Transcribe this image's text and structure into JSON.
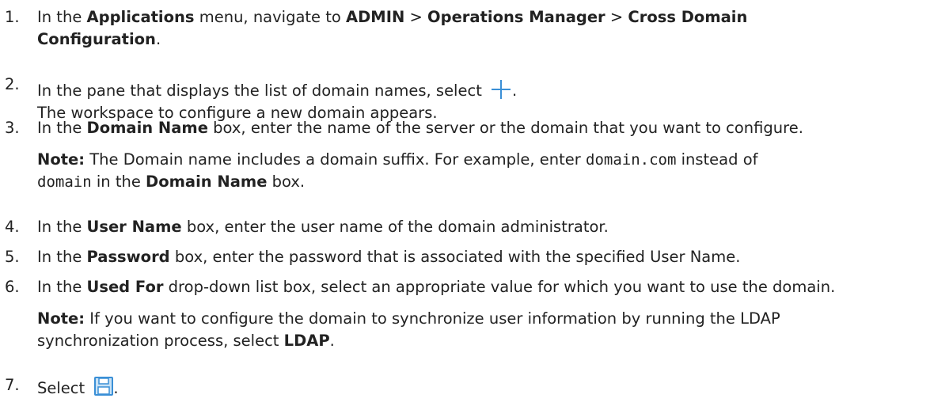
{
  "steps": [
    {
      "num": "1.",
      "a": "In the ",
      "b1": "Applications",
      "c": " menu, navigate to ",
      "b2": "ADMIN",
      "d": " > ",
      "b3": "Operations Manager",
      "e": " > ",
      "b4": "Cross Domain",
      "b5": "Configuration",
      "f": "."
    },
    {
      "num": "2.",
      "a": "In the pane that displays the list of domain names, select ",
      "icon": "plus-icon",
      "b": ".",
      "c": "The workspace to configure a new domain appears."
    },
    {
      "num": "3.",
      "a": "In the ",
      "b1": "Domain Name",
      "c": " box, enter the name of the server or the domain that you want to configure.",
      "note_label": "Note:",
      "note_a": " The Domain name includes a domain suffix. For example, enter ",
      "code1": "domain.com",
      "note_b": " instead of",
      "code2": "domain",
      "note_c": " in the ",
      "note_b2": "Domain Name",
      "note_d": " box."
    },
    {
      "num": "4.",
      "a": "In the ",
      "b1": "User Name",
      "c": " box, enter the user name of the domain administrator."
    },
    {
      "num": "5.",
      "a": "In the ",
      "b1": "Password",
      "c": " box, enter the password that is associated with the specified User Name."
    },
    {
      "num": "6.",
      "a": "In the ",
      "b1": "Used For",
      "c": " drop-down list box, select an appropriate value for which you want to use the domain.",
      "note_label": "Note:",
      "note_a": " If you want to configure the domain to synchronize user information by running the LDAP",
      "note_b": "synchronization process, select ",
      "note_b2": "LDAP",
      "note_c": "."
    },
    {
      "num": "7.",
      "a": "Select ",
      "icon": "save-icon",
      "b": "."
    }
  ],
  "colors": {
    "text": "#222222",
    "icon_blue": "#3a8fd6",
    "icon_light_blue": "#c8e2f6"
  }
}
